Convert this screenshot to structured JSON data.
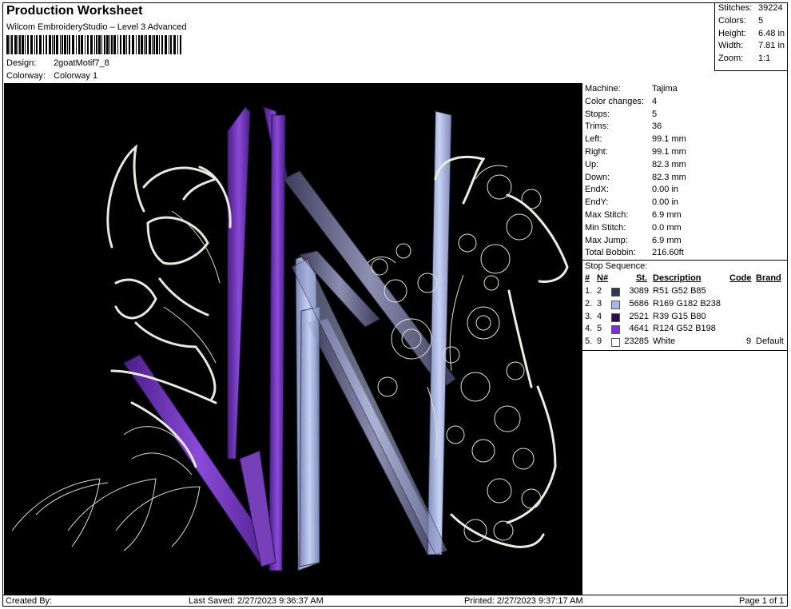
{
  "header": {
    "title": "Production Worksheet",
    "subtitle": "Wilcom EmbroideryStudio – Level 3 Advanced",
    "design_label": "Design:",
    "design_value": "2goatMotif7_8",
    "colorway_label": "Colorway:",
    "colorway_value": "Colorway 1"
  },
  "summary": [
    {
      "label": "Stitches:",
      "value": "39224"
    },
    {
      "label": "Colors:",
      "value": "5"
    },
    {
      "label": "Height:",
      "value": "6.48 in"
    },
    {
      "label": "Width:",
      "value": "7.81 in"
    },
    {
      "label": "Zoom:",
      "value": "1:1"
    }
  ],
  "properties": [
    {
      "label": "Machine:",
      "value": "Tajima"
    },
    {
      "label": "Color changes:",
      "value": "4"
    },
    {
      "label": "Stops:",
      "value": "5"
    },
    {
      "label": "Trims:",
      "value": "36"
    },
    {
      "label": "Left:",
      "value": "99.1 mm"
    },
    {
      "label": "Right:",
      "value": "99.1 mm"
    },
    {
      "label": "Up:",
      "value": "82.3 mm"
    },
    {
      "label": "Down:",
      "value": "82.3 mm"
    },
    {
      "label": "EndX:",
      "value": "0.00 in"
    },
    {
      "label": "EndY:",
      "value": "0.00 in"
    },
    {
      "label": "Max Stitch:",
      "value": "6.9 mm"
    },
    {
      "label": "Min Stitch:",
      "value": "0.0 mm"
    },
    {
      "label": "Max Jump:",
      "value": "6.9 mm"
    },
    {
      "label": "Total Bobbin:",
      "value": "216.60ft"
    }
  ],
  "stop_sequence": {
    "title": "Stop Sequence:",
    "headers": {
      "num": "#",
      "n": "N#",
      "st": "St.",
      "desc": "Description",
      "code": "Code",
      "brand": "Brand"
    },
    "rows": [
      {
        "num": "1.",
        "n": "2",
        "color": "#333455",
        "st": "3089",
        "desc": "R51 G52 B85",
        "code": "",
        "brand": ""
      },
      {
        "num": "2.",
        "n": "3",
        "color": "#a9b6ee",
        "st": "5686",
        "desc": "R169 G182 B238",
        "code": "",
        "brand": ""
      },
      {
        "num": "3.",
        "n": "4",
        "color": "#270f50",
        "st": "2521",
        "desc": "R39 G15 B80",
        "code": "",
        "brand": ""
      },
      {
        "num": "4.",
        "n": "5",
        "color": "#7c34c6",
        "st": "4641",
        "desc": "R124 G52 B198",
        "code": "",
        "brand": ""
      },
      {
        "num": "5.",
        "n": "9",
        "color": "#ffffff",
        "st": "23285",
        "desc": "White",
        "code": "9",
        "brand": "Default"
      }
    ]
  },
  "footer": {
    "created_by": "Created By:",
    "last_saved": "Last Saved: 2/27/2023 9:36:37 AM",
    "printed": "Printed: 2/27/2023 9:37:17 AM",
    "page": "Page 1 of 1"
  }
}
